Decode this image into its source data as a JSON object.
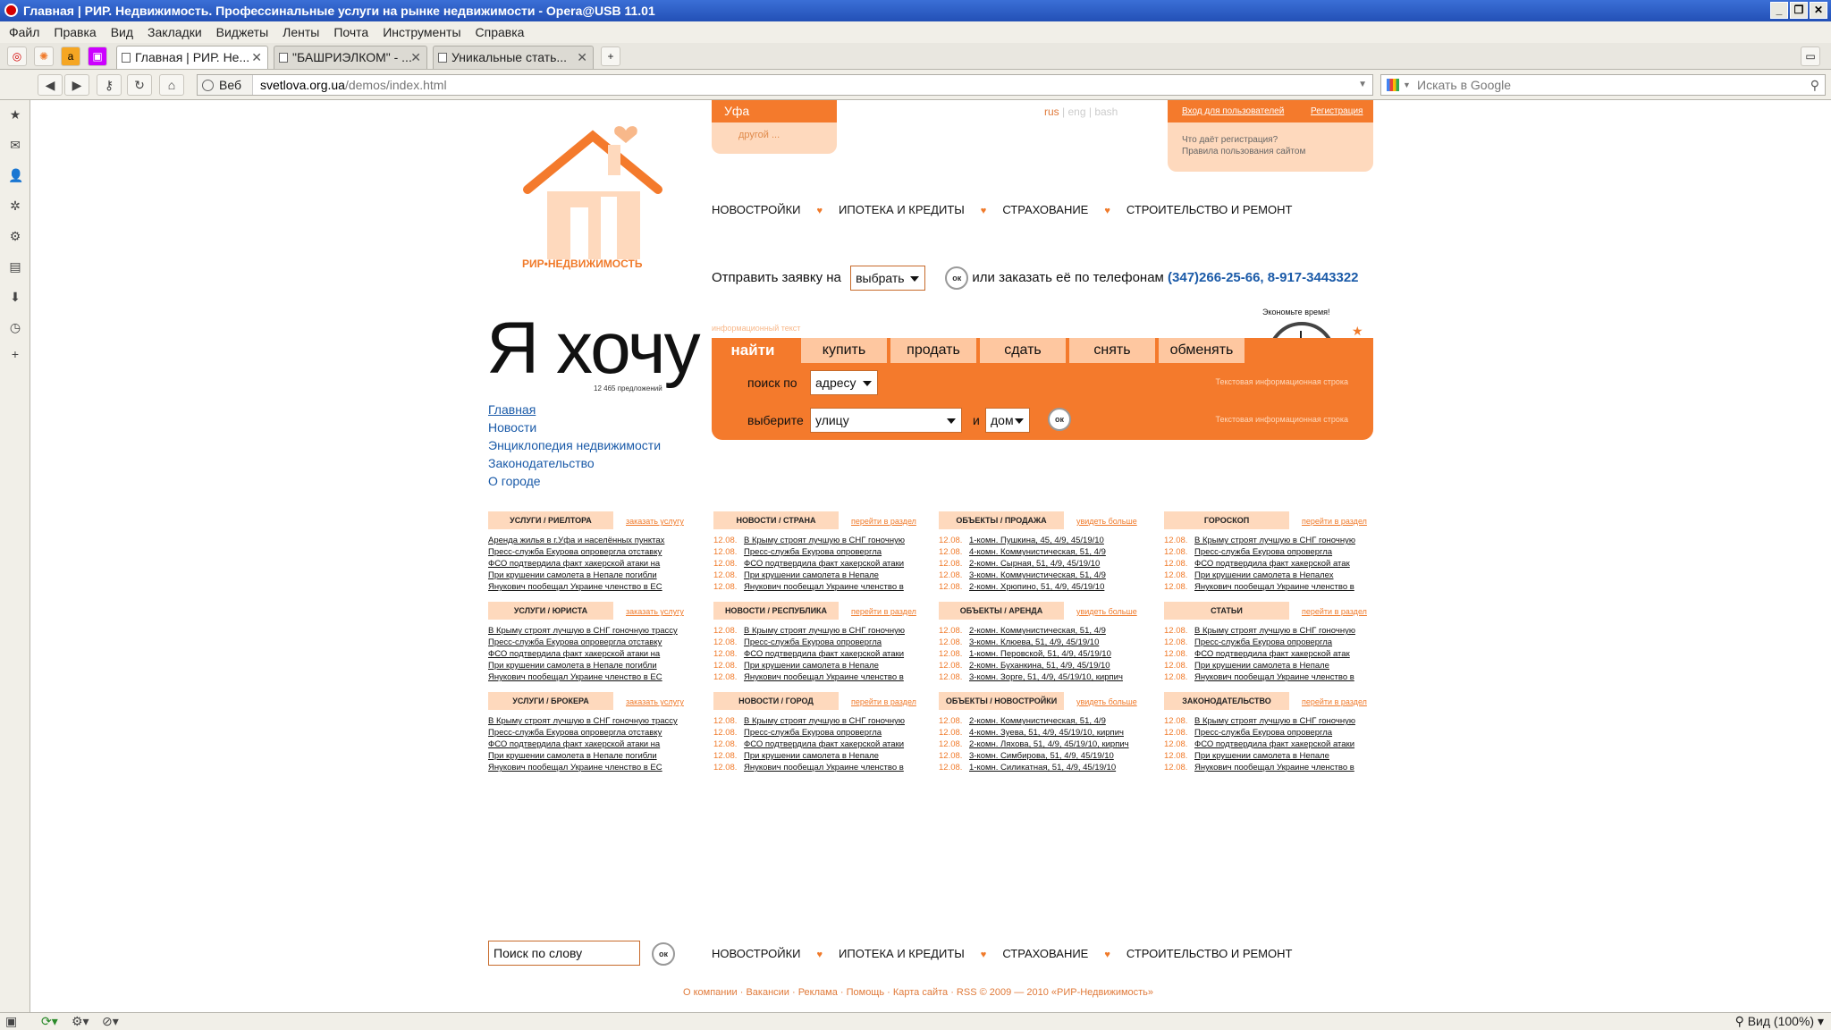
{
  "window": {
    "title": "Главная | РИР. Недвижимость. Профессинальные услуги на рынке недвижимости - Opera@USB 11.01"
  },
  "menu": [
    "Файл",
    "Правка",
    "Вид",
    "Закладки",
    "Виджеты",
    "Ленты",
    "Почта",
    "Инструменты",
    "Справка"
  ],
  "tabs": [
    {
      "label": "Главная | РИР. Не...",
      "active": true
    },
    {
      "label": "\"БАШРИЭЛКОМ\" - ...",
      "active": false
    },
    {
      "label": "Уникальные стать...",
      "active": false
    }
  ],
  "address": {
    "veb_label": "Веб",
    "host": "svetlova.org.ua",
    "path": "/demos/index.html",
    "search_placeholder": "Искать в Google"
  },
  "status": {
    "zoom": "Вид (100%)"
  },
  "site": {
    "logo_text": "РИР•НЕДВИЖИМОСТЬ",
    "city": "Уфа",
    "city_other": "другой ...",
    "langs": [
      "rus",
      "eng",
      "bash"
    ],
    "login_link": "Вход для пользователей",
    "register_link": "Регистрация",
    "login_info1": "Что даёт регистрация?",
    "login_info2": "Правила пользования сайтом",
    "nav": [
      "НОВОСТРОЙКИ",
      "ИПОТЕКА И КРЕДИТЫ",
      "СТРАХОВАНИЕ",
      "СТРОИТЕЛЬСТВО И РЕМОНТ"
    ],
    "order_prefix": "Отправить заявку на",
    "order_select": "выбрать",
    "order_ok": "ок",
    "order_suffix": "или заказать её по телефонам",
    "phones": "(347)266-25-66, 8-917-3443322",
    "want": "Я хочу",
    "offers": "12 465 предложений",
    "info_small": "информационный текст",
    "save_time": "Экономьте время!",
    "left_menu": [
      "Главная",
      "Новости",
      "Энциклопедия недвижимости",
      "Законодательство",
      "О городе"
    ],
    "search_tabs": [
      "найти",
      "купить",
      "продать",
      "сдать",
      "снять",
      "обменять"
    ],
    "search_by_label": "поиск по",
    "search_by_value": "адресу",
    "choose_label": "выберите",
    "choose_value": "улицу",
    "and_label": "и",
    "house_value": "дом",
    "info_line": "Текстовая информационная строка",
    "footer_search": "Поиск по слову",
    "footer_links": "О компании · Вакансии · Реклама · Помощь · Карта сайта · RSS     © 2009 — 2010  «РИР-Недвижимость»"
  },
  "blocks": [
    {
      "title": "УСЛУГИ / РИЕЛТОРА",
      "more": "заказать услугу",
      "dated": false,
      "items": [
        "Аренда жилья в г.Уфа и населённых пунктах",
        "Пресс-служба Екурова опровергла отставку",
        "ФСО подтвердила факт хакерской атаки на",
        "При крушении самолета в Непале погибли",
        "Янукович пообещал Украине членство в ЕС"
      ]
    },
    {
      "title": "НОВОСТИ / СТРАНА",
      "more": "перейти в раздел",
      "dated": true,
      "items": [
        "В Крыму строят лучшую в СНГ гоночную",
        "Пресс-служба Екурова опровергла",
        "ФСО подтвердила факт хакерской атаки",
        "При крушении самолета в Непале",
        "Янукович пообещал Украине членство в"
      ]
    },
    {
      "title": "ОБЪЕКТЫ / ПРОДАЖА",
      "more": "увидеть больше",
      "dated": true,
      "items": [
        "1-комн. Пушкина, 45, 4/9, 45/19/10",
        "4-комн. Коммунистическая, 51, 4/9",
        "2-комн. Сырная, 51, 4/9, 45/19/10",
        "3-комн. Коммунистическая, 51, 4/9",
        "2-комн. Хрюпино, 51, 4/9, 45/19/10"
      ]
    },
    {
      "title": "ГОРОСКОП",
      "more": "перейти в раздел",
      "dated": true,
      "items": [
        "В Крыму строят лучшую в СНГ гоночную",
        "Пресс-служба Екурова опровергла",
        "ФСО подтвердила факт хакерской атак",
        "При крушении самолета в Непалех",
        "Янукович пообещал Украине членство в"
      ]
    },
    {
      "title": "УСЛУГИ / ЮРИСТА",
      "more": "заказать услугу",
      "dated": false,
      "items": [
        "В Крыму строят лучшую в СНГ гоночную трассу",
        "Пресс-служба Екурова опровергла отставку",
        "ФСО подтвердила факт хакерской атаки на",
        "При крушении самолета в Непале погибли",
        "Янукович пообещал Украине членство в ЕС"
      ]
    },
    {
      "title": "НОВОСТИ / РЕСПУБЛИКА",
      "more": "перейти в раздел",
      "dated": true,
      "items": [
        "В Крыму строят лучшую в СНГ гоночную",
        "Пресс-служба Екурова опровергла",
        "ФСО подтвердила факт хакерской атаки",
        "При крушении самолета в Непале",
        "Янукович пообещал Украине членство в"
      ]
    },
    {
      "title": "ОБЪЕКТЫ / АРЕНДА",
      "more": "увидеть больше",
      "dated": true,
      "items": [
        "2-комн. Коммунистическая, 51, 4/9",
        "3-комн. Клюева, 51, 4/9, 45/19/10",
        "1-комн. Перовской, 51, 4/9, 45/19/10",
        "2-комн. Буханкина, 51, 4/9, 45/19/10",
        "3-комн. Зорге, 51, 4/9, 45/19/10, кирпич"
      ]
    },
    {
      "title": "СТАТЬИ",
      "more": "перейти в раздел",
      "dated": true,
      "items": [
        "В Крыму строят лучшую в СНГ гоночную",
        "Пресс-служба Екурова опровергла",
        "ФСО подтвердила факт хакерской атак",
        "При крушении самолета в Непале",
        "Янукович пообещал Украине членство в"
      ]
    },
    {
      "title": "УСЛУГИ / БРОКЕРА",
      "more": "заказать услугу",
      "dated": false,
      "items": [
        "В Крыму строят лучшую в СНГ гоночную трассу",
        "Пресс-служба Екурова опровергла отставку",
        "ФСО подтвердила факт хакерской атаки на",
        "При крушении самолета в Непале погибли",
        "Янукович пообещал Украине членство в ЕС"
      ]
    },
    {
      "title": "НОВОСТИ / ГОРОД",
      "more": "перейти в раздел",
      "dated": true,
      "items": [
        "В Крыму строят лучшую в СНГ гоночную",
        "Пресс-служба Екурова опровергла",
        "ФСО подтвердила факт хакерской атаки",
        "При крушении самолета в Непале",
        "Янукович пообещал Украине членство в"
      ]
    },
    {
      "title": "ОБЪЕКТЫ / НОВОСТРОЙКИ",
      "more": "увидеть больше",
      "dated": true,
      "items": [
        "2-комн. Коммунистическая, 51, 4/9",
        "4-комн. Зуева, 51, 4/9, 45/19/10, кирпич",
        "2-комн. Ляхова, 51, 4/9, 45/19/10, кирпич",
        "3-комн. Симбирова, 51, 4/9, 45/19/10",
        "1-комн. Силикатная, 51, 4/9, 45/19/10"
      ]
    },
    {
      "title": "ЗАКОНОДАТЕЛЬСТВО",
      "more": "перейти в раздел",
      "dated": true,
      "items": [
        "В Крыму строят лучшую в СНГ гоночную",
        "Пресс-служба Екурова опровергла",
        "ФСО подтвердила факт хакерской атаки",
        "При крушении самолета в Непале",
        "Янукович пообещал Украине членство в"
      ]
    }
  ],
  "item_date": "12.08.",
  "colors": {
    "accent": "#f47a2c",
    "light": "#fed9bd",
    "link": "#1a5aa8"
  }
}
